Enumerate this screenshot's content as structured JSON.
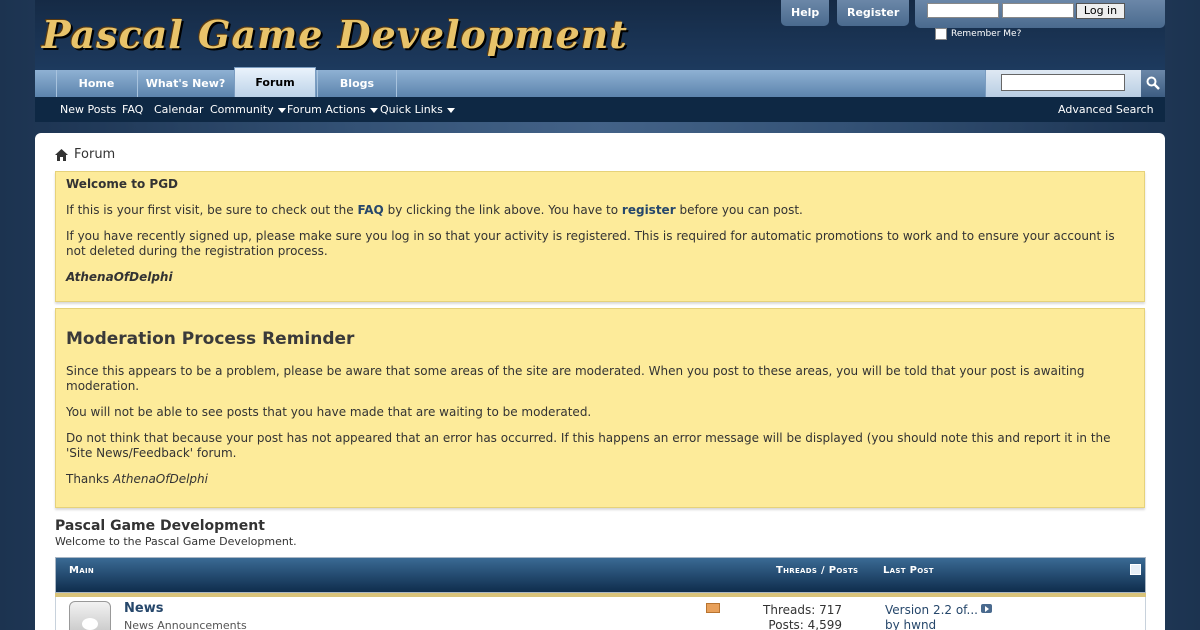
{
  "site": {
    "logo": "Pascal Game Development"
  },
  "header": {
    "help_label": "Help",
    "register_label": "Register",
    "login": {
      "username_value": "",
      "password_value": "",
      "login_label": "Log in",
      "remember_label": "Remember Me?"
    }
  },
  "nav": {
    "tabs": [
      {
        "label": "Home"
      },
      {
        "label": "What's New?"
      },
      {
        "label": "Forum"
      },
      {
        "label": "Blogs"
      }
    ],
    "active_tab": "Forum",
    "search_value": ""
  },
  "subnav": {
    "items": [
      {
        "label": "New Posts"
      },
      {
        "label": "FAQ"
      },
      {
        "label": "Calendar"
      },
      {
        "label": "Community"
      },
      {
        "label": "Forum Actions"
      },
      {
        "label": "Quick Links"
      }
    ],
    "advanced_search": "Advanced Search"
  },
  "breadcrumb": {
    "label": "Forum"
  },
  "notice1": {
    "title": "Welcome to PGD",
    "p1_before": "If this is your first visit, be sure to check out the",
    "p1_faq": "FAQ",
    "p1_middle": "by clicking the link above. You have to",
    "p1_register": "register",
    "p1_after": "before you can post.",
    "p2": "If you have recently signed up, please make sure you log in so that your activity is registered. This is required for automatic promotions to work and to ensure your account is not deleted during the registration process.",
    "signature": "AthenaOfDelphi"
  },
  "notice2": {
    "title": "Moderation Process Reminder",
    "p1": "Since this appears to be a problem, please be aware that some areas of the site are moderated. When you post to these areas, you will be told that your post is awaiting moderation.",
    "p2": "You will not be able to see posts that you have made that are waiting to be moderated.",
    "p3": "Do not think that because your post has not appeared that an error has occurred. If this happens an error message will be displayed (you should note this and report it in the 'Site News/Feedback' forum.",
    "thanks": "Thanks",
    "signature": "AthenaOfDelphi"
  },
  "forum": {
    "title": "Pascal Game Development",
    "description": "Welcome to the Pascal Game Development.",
    "category": {
      "label": "Main",
      "threads_posts_label": "Threads / Posts",
      "last_post_label": "Last Post"
    },
    "rows": [
      {
        "name": "News",
        "description": "News Announcements",
        "threads": "Threads: 717",
        "posts": "Posts: 4,599",
        "last_post_title": "Version 2.2 of...",
        "last_post_by": "by hwnd"
      }
    ]
  }
}
